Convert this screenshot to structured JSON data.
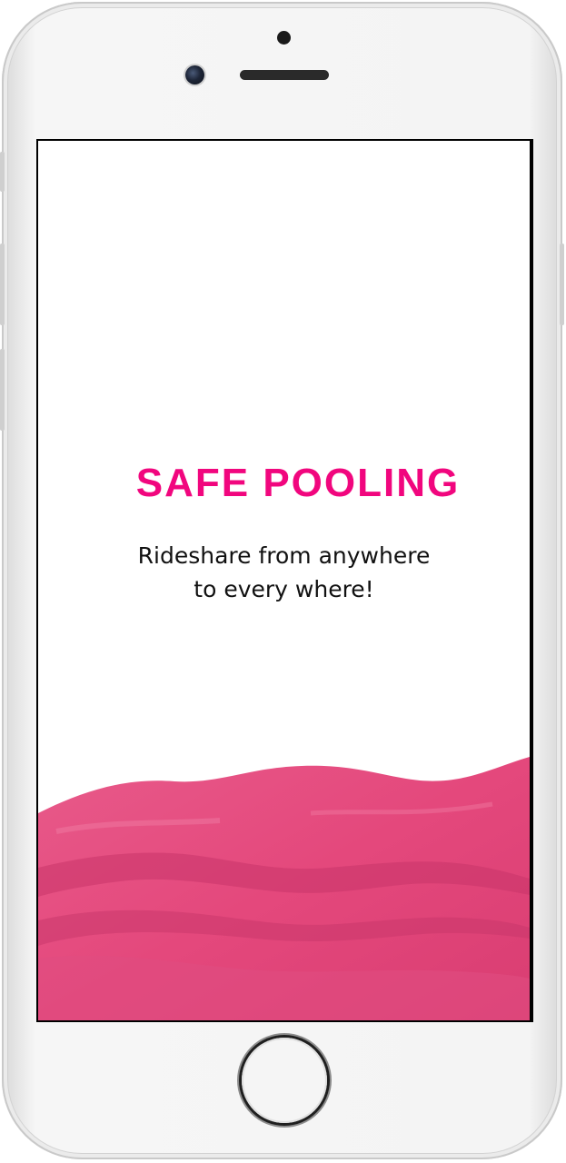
{
  "app": {
    "title": "SAFE POOLING",
    "tagline_line1": "Rideshare from anywhere",
    "tagline_line2": "to every where!"
  },
  "colors": {
    "brand_pink": "#f1067e",
    "watercolor_pink": "#e6477e",
    "text_dark": "#111111",
    "screen_bg": "#ffffff"
  },
  "icons": {
    "front_camera": "front-camera-icon",
    "speaker": "earpiece-speaker-icon",
    "home": "home-button-icon"
  }
}
